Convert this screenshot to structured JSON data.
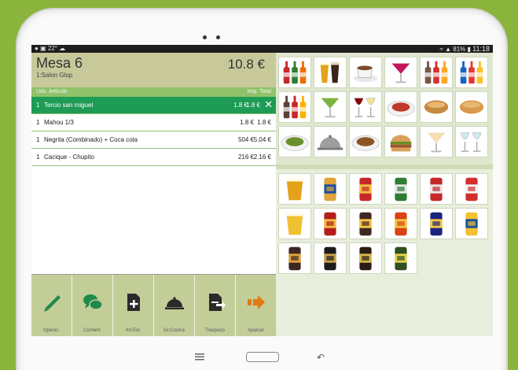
{
  "statusbar": {
    "left": "22°",
    "right": "81%",
    "time": "11:18"
  },
  "order": {
    "title": "Mesa 6",
    "room": "1:Salon Glop",
    "total": "10.8 €",
    "columns": {
      "left": "Uds.  Artículo",
      "right": "Imp.  Total"
    },
    "items": [
      {
        "qty": "1",
        "name": "Tercio san miguel",
        "price": "1.8 €",
        "total": "1.8 €",
        "selected": true
      },
      {
        "qty": "1",
        "name": "Mahou 1/3",
        "price": "1.8 €",
        "total": "1.8 €",
        "selected": false
      },
      {
        "qty": "1",
        "name": "Negrita (Combinado) + Coca cola",
        "price": "504 €",
        "total": "5.04 €",
        "selected": false
      },
      {
        "qty": "1",
        "name": "Cacique - Chupito",
        "price": "216 €",
        "total": "2.16 €",
        "selected": false
      }
    ]
  },
  "toolbar": [
    {
      "label": "Operac.",
      "icon": "pencil-icon"
    },
    {
      "label": "Coment.",
      "icon": "chat-icon"
    },
    {
      "label": "Art.Ext.",
      "icon": "add-document-icon"
    },
    {
      "label": "Gr.Cocina",
      "icon": "cloche-icon"
    },
    {
      "label": "Traspaso",
      "icon": "transfer-document-icon"
    },
    {
      "label": "Aparcar",
      "icon": "arrow-right-icon"
    }
  ],
  "categories": [
    {
      "name": "soft-drinks-icon",
      "kind": "bottles",
      "colors": [
        "#c62828",
        "#2e7d32",
        "#ef6c00"
      ]
    },
    {
      "name": "beer-glasses-icon",
      "kind": "glasses",
      "colors": [
        "#e3a21a",
        "#3b2418"
      ]
    },
    {
      "name": "coffee-cup-icon",
      "kind": "cup",
      "colors": [
        "#7b4a2a"
      ]
    },
    {
      "name": "cocktail-icon",
      "kind": "cocktail",
      "colors": [
        "#c2185b"
      ]
    },
    {
      "name": "liquor-bottles-icon",
      "kind": "bottles",
      "colors": [
        "#795548",
        "#d32f2f",
        "#f9a825"
      ]
    },
    {
      "name": "spirits-icon",
      "kind": "bottles",
      "colors": [
        "#1565c0",
        "#e53935",
        "#fbc02d"
      ]
    },
    {
      "name": "liqueur-bottles-icon",
      "kind": "bottles",
      "colors": [
        "#5d4037",
        "#c62828",
        "#ffb300"
      ]
    },
    {
      "name": "mojito-icon",
      "kind": "cocktail",
      "colors": [
        "#7cb342"
      ]
    },
    {
      "name": "wine-glasses-icon",
      "kind": "wine",
      "colors": [
        "#8e0000",
        "#f1e39a"
      ]
    },
    {
      "name": "tapas-plate-icon",
      "kind": "plate",
      "colors": [
        "#c0392b"
      ]
    },
    {
      "name": "bread-icon",
      "kind": "bread",
      "colors": [
        "#c58940"
      ]
    },
    {
      "name": "sandwich-icon",
      "kind": "bread",
      "colors": [
        "#d99a4e"
      ]
    },
    {
      "name": "salad-plate-icon",
      "kind": "plate",
      "colors": [
        "#6a8f2f"
      ]
    },
    {
      "name": "dish-cover-icon",
      "kind": "cloche",
      "colors": [
        "#9e9e9e"
      ]
    },
    {
      "name": "main-dish-icon",
      "kind": "plate",
      "colors": [
        "#8d5524"
      ]
    },
    {
      "name": "burger-icon",
      "kind": "burger",
      "colors": [
        "#a0522d"
      ]
    },
    {
      "name": "ice-cream-icon",
      "kind": "cocktail",
      "colors": [
        "#f5deb3"
      ]
    },
    {
      "name": "gin-tonic-icon",
      "kind": "wine",
      "colors": [
        "#cfe8ef",
        "#cfe8ef"
      ]
    }
  ],
  "products": [
    {
      "name": "draft-beer-icon",
      "kind": "glass",
      "colors": [
        "#e3a21a"
      ]
    },
    {
      "name": "mahou-bottle-icon",
      "kind": "bottle",
      "colors": [
        "#e0a43a",
        "#1a4fa0"
      ]
    },
    {
      "name": "mahou-can-icon",
      "kind": "bottle",
      "colors": [
        "#c62828",
        "#f0c040"
      ]
    },
    {
      "name": "heineken-can-icon",
      "kind": "bottle",
      "colors": [
        "#2e7d32",
        "#e8e8e8"
      ]
    },
    {
      "name": "estrella-can-icon",
      "kind": "bottle",
      "colors": [
        "#c62828",
        "#e8e8e8"
      ]
    },
    {
      "name": "san-miguel-can-icon",
      "kind": "bottle",
      "colors": [
        "#d32f2f",
        "#f5f5f5"
      ]
    },
    {
      "name": "lemon-beer-icon",
      "kind": "glass",
      "colors": [
        "#f0c030"
      ]
    },
    {
      "name": "amstel-bottle-icon",
      "kind": "bottle",
      "colors": [
        "#b71c1c",
        "#f0c040"
      ]
    },
    {
      "name": "dark-beer-bottle-icon",
      "kind": "bottle",
      "colors": [
        "#3e2723",
        "#f5c542"
      ]
    },
    {
      "name": "red-label-bottle-icon",
      "kind": "bottle",
      "colors": [
        "#d84315",
        "#f5c542"
      ]
    },
    {
      "name": "blue-can-icon",
      "kind": "bottle",
      "colors": [
        "#1a237e",
        "#f5c542"
      ]
    },
    {
      "name": "coronita-bottle-icon",
      "kind": "bottle",
      "colors": [
        "#f2c230",
        "#1a4fa0"
      ]
    },
    {
      "name": "mahou-negra-icon",
      "kind": "bottle",
      "colors": [
        "#3e2723",
        "#e0a43a"
      ]
    },
    {
      "name": "extra-smooth-icon",
      "kind": "bottle",
      "colors": [
        "#1b1b1b",
        "#c8a24a"
      ]
    },
    {
      "name": "alhambra-bottle-icon",
      "kind": "bottle",
      "colors": [
        "#2b1d14",
        "#d8b64c"
      ]
    },
    {
      "name": "green-beer-bottle-icon",
      "kind": "bottle",
      "colors": [
        "#2f4f1f",
        "#e5d24a"
      ]
    }
  ]
}
